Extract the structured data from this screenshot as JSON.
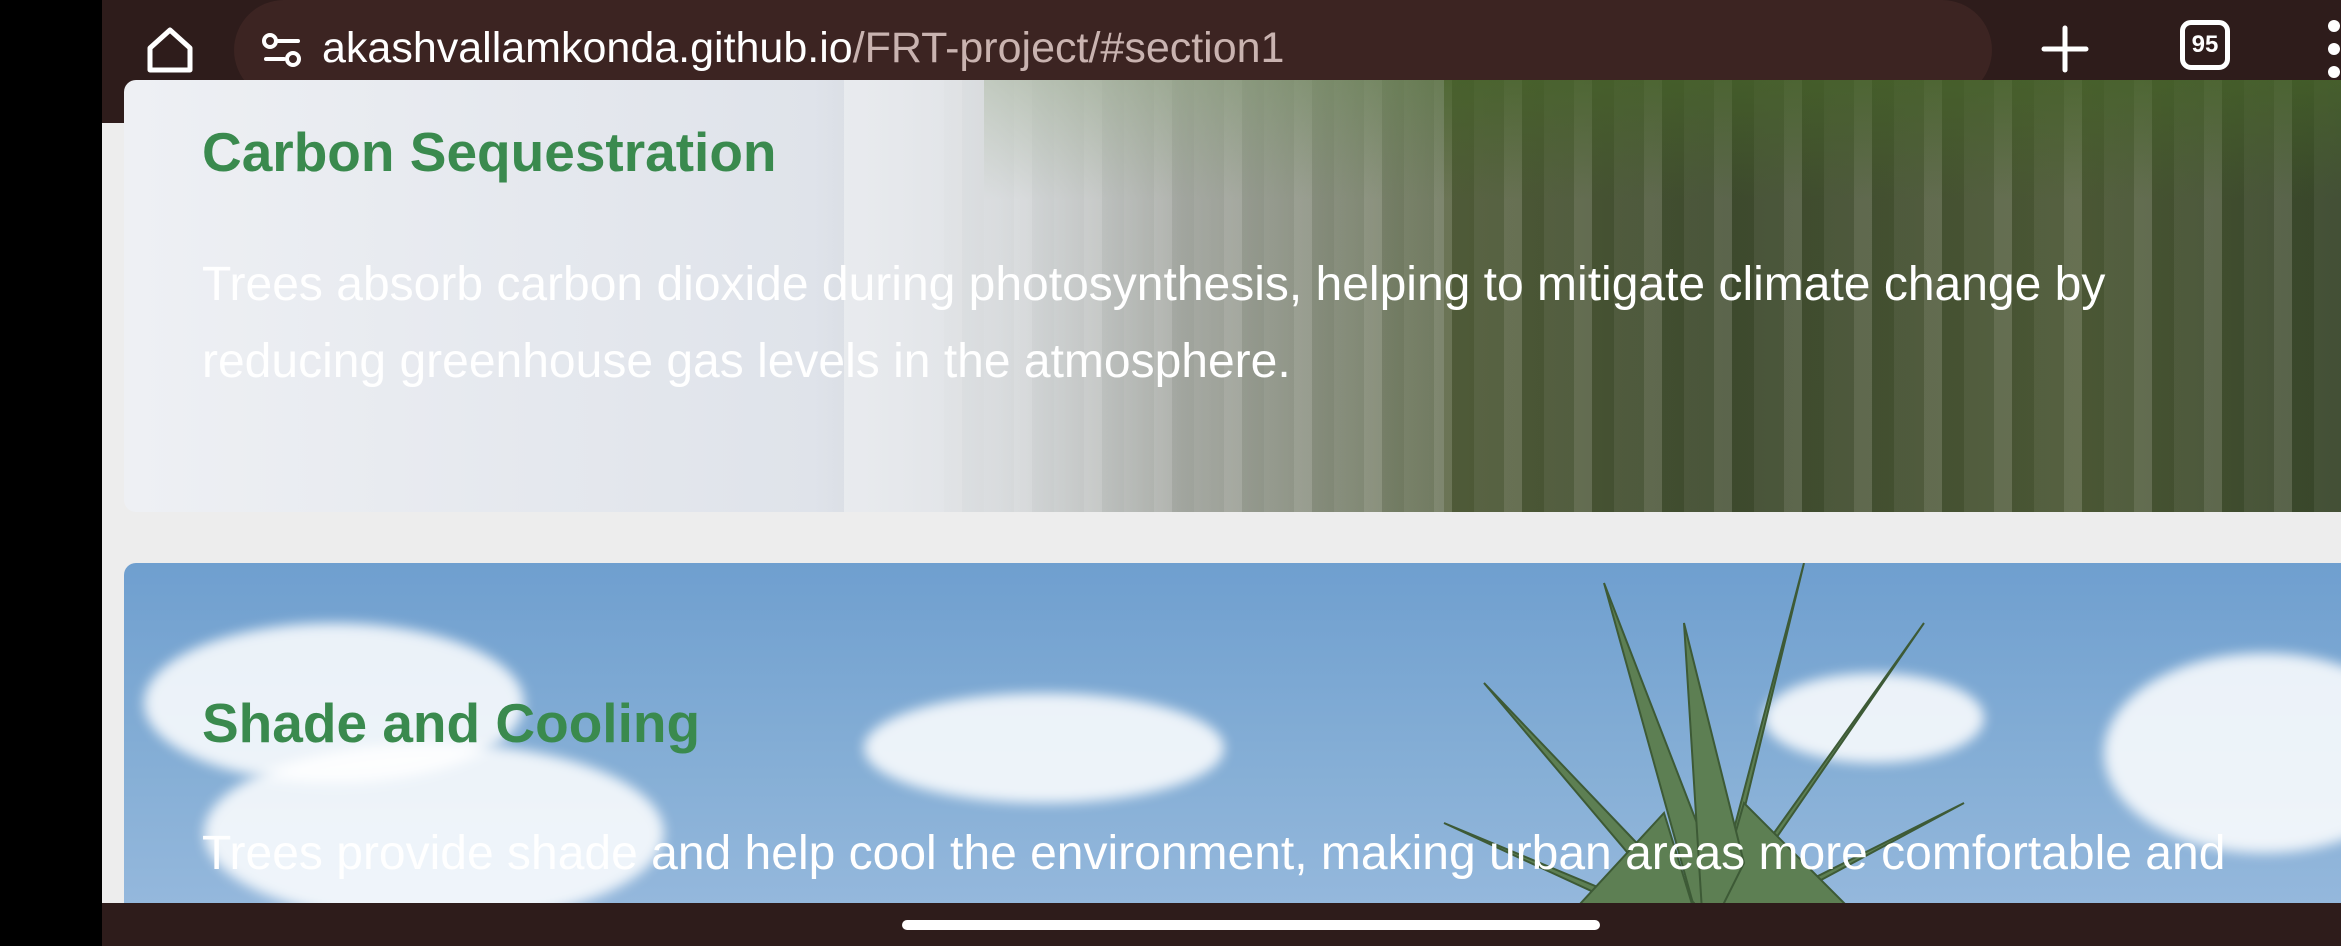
{
  "browser": {
    "url_host": "akashvallamkonda.github.io",
    "url_path": "/FRT-project/#section1",
    "tab_count": "95",
    "icons": {
      "home": "home-icon",
      "site_info": "site-settings-icon",
      "new_tab": "plus-icon",
      "tabs": "tab-switcher-icon",
      "menu": "overflow-menu-icon"
    }
  },
  "sections": [
    {
      "title": "Carbon Sequestration",
      "text_line1": "Trees absorb carbon dioxide during photosynthesis, helping to mitigate climate change by",
      "text_line2": "reducing greenhouse gas levels in the atmosphere."
    },
    {
      "title": "Shade and Cooling",
      "text_line1": "Trees provide shade and help cool the environment, making urban areas more comfortable and"
    }
  ],
  "colors": {
    "toolbar_bg": "#2e1c1b",
    "url_bar_bg": "#3c2422",
    "heading_green": "#3a8a4e",
    "page_bg": "#ededed"
  }
}
